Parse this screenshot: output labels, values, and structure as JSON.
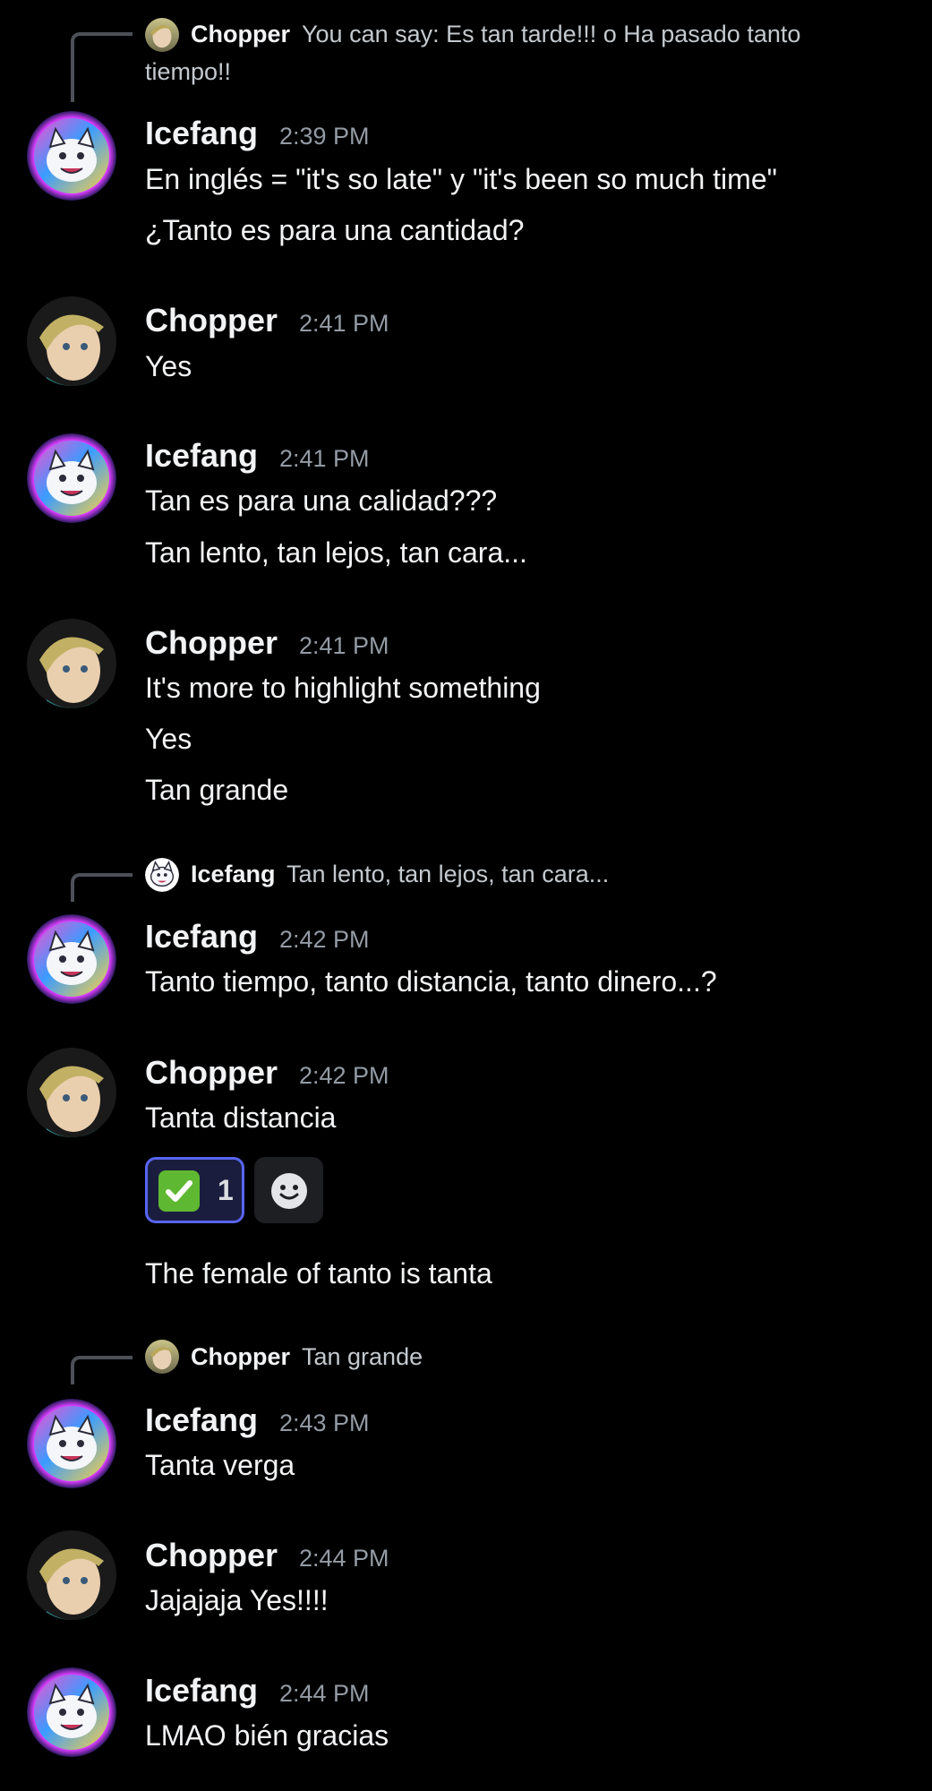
{
  "users": {
    "icefang": {
      "name": "Icefang"
    },
    "chopper": {
      "name": "Chopper"
    }
  },
  "messages": [
    {
      "reply": {
        "author": "Chopper",
        "text_line1": "You can say: Es tan tarde!!! o Ha pasado tanto",
        "text_line2": "tiempo!!"
      },
      "author": "Icefang",
      "time": "2:39 PM",
      "lines": [
        "En inglés = \"it's so late\" y \"it's been so much time\"",
        "¿Tanto es para una cantidad?"
      ]
    },
    {
      "author": "Chopper",
      "time": "2:41 PM",
      "lines": [
        "Yes"
      ]
    },
    {
      "author": "Icefang",
      "time": "2:41 PM",
      "lines": [
        "Tan es para una calidad???",
        "Tan lento, tan lejos, tan cara..."
      ]
    },
    {
      "author": "Chopper",
      "time": "2:41 PM",
      "lines": [
        "It's more to highlight something",
        "Yes",
        "Tan grande"
      ]
    },
    {
      "reply": {
        "author": "Icefang",
        "text": "Tan lento, tan lejos, tan cara..."
      },
      "author": "Icefang",
      "time": "2:42 PM",
      "lines": [
        "Tanto tiempo, tanto distancia, tanto dinero...?"
      ]
    },
    {
      "author": "Chopper",
      "time": "2:42 PM",
      "lines": [
        "Tanta distancia",
        "The female of tanto is tanta"
      ],
      "reaction": {
        "emoji": "white-check-mark",
        "count": "1"
      }
    },
    {
      "reply": {
        "author": "Chopper",
        "text": "Tan grande"
      },
      "author": "Icefang",
      "time": "2:43 PM",
      "lines": [
        "Tanta verga"
      ]
    },
    {
      "author": "Chopper",
      "time": "2:44 PM",
      "lines": [
        "Jajajaja Yes!!!!"
      ]
    },
    {
      "author": "Icefang",
      "time": "2:44 PM",
      "lines": [
        "LMAO bién gracias"
      ]
    }
  ],
  "icons": {
    "reply_spine": "reply-spine-icon",
    "add_reaction": "add-reaction-smiley-icon",
    "reaction_emoji": "white-check-mark-icon"
  },
  "colors": {
    "background": "#000000",
    "accent": "#5865f2",
    "timestamp": "#949ba4",
    "check_green": "#5fb832"
  }
}
